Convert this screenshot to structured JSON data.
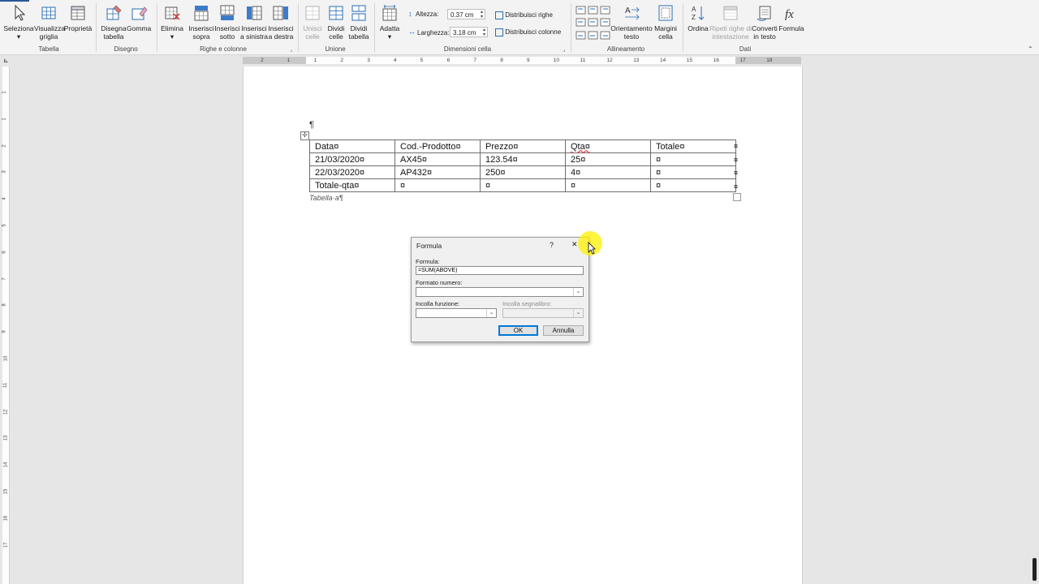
{
  "ribbon": {
    "groups": {
      "tabella": "Tabella",
      "disegno": "Disegno",
      "righe": "Righe e colonne",
      "unione": "Unione",
      "dimensioni": "Dimensioni cella",
      "allineamento": "Allineamento",
      "dati": "Dati"
    },
    "buttons": {
      "seleziona": [
        "Seleziona",
        "▾"
      ],
      "visualizza": [
        "Visualizza",
        "griglia"
      ],
      "proprieta": [
        "Proprietà",
        ""
      ],
      "disegna": [
        "Disegna",
        "tabella"
      ],
      "gomma": [
        "Gomma",
        ""
      ],
      "elimina": [
        "Elimina",
        "▾"
      ],
      "ins_sopra": [
        "Inserisci",
        "sopra"
      ],
      "ins_sotto": [
        "Inserisci",
        "sotto"
      ],
      "ins_sinistra": [
        "Inserisci",
        "a sinistra"
      ],
      "ins_destra": [
        "Inserisci",
        "a destra"
      ],
      "unisci": [
        "Unisci",
        "celle"
      ],
      "dividi_celle": [
        "Dividi",
        "celle"
      ],
      "dividi_tabella": [
        "Dividi",
        "tabella"
      ],
      "adatta": [
        "Adatta",
        "▾"
      ],
      "orientamento": [
        "Orientamento",
        "testo"
      ],
      "margini": [
        "Margini",
        "cella"
      ],
      "ordina": [
        "Ordina",
        ""
      ],
      "ripeti": [
        "Ripeti righe di",
        "intestazione"
      ],
      "converti": [
        "Converti",
        "in testo"
      ],
      "formula": [
        "Formula",
        ""
      ]
    },
    "altezza_label": "Altezza:",
    "altezza_value": "0.37 cm",
    "larghezza_label": "Larghezza:",
    "larghezza_value": "3.18 cm",
    "distribuisci_righe": "Distribuisci righe",
    "distribuisci_colonne": "Distribuisci colonne"
  },
  "ruler": {
    "h_numbers": [
      "2",
      "1",
      "1",
      "2",
      "3",
      "4",
      "5",
      "6",
      "7",
      "8",
      "9",
      "10",
      "11",
      "12",
      "13",
      "14",
      "15",
      "16",
      "17",
      "18"
    ],
    "v_numbers": [
      "1",
      "1",
      "2",
      "3",
      "4",
      "5",
      "6",
      "7",
      "8",
      "9",
      "10",
      "11",
      "12",
      "13",
      "14",
      "15",
      "16",
      "17"
    ]
  },
  "document": {
    "pilcrow": "¶",
    "table": [
      [
        "Data¤",
        "Cod.-Prodotto¤",
        "Prezzo¤",
        "Qta¤",
        "Totale¤"
      ],
      [
        "21/03/2020¤",
        "AX45¤",
        "123.54¤",
        "25¤",
        "¤"
      ],
      [
        "22/03/2020¤",
        "AP432¤",
        "250¤",
        "4¤",
        "¤"
      ],
      [
        "Totale-qta¤",
        "¤",
        "¤",
        "¤",
        "¤"
      ]
    ],
    "row_end_mark": "¤",
    "caption": "Tabella·a¶"
  },
  "dialog": {
    "title": "Formula",
    "help": "?",
    "close": "✕",
    "formula_label": "Formula:",
    "formula_value": "=SUM(ABOVE)",
    "formato_label": "Formato numero:",
    "funzione_label": "Incolla funzione:",
    "segnalibro_label": "Incolla segnalibro:",
    "ok": "OK",
    "annulla": "Annulla"
  }
}
